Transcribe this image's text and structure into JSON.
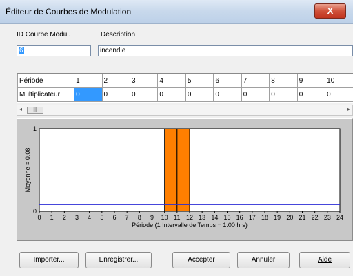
{
  "window": {
    "title": "Éditeur de Courbes de Modulation",
    "close_label": "X"
  },
  "form": {
    "id_label": "ID Courbe Modul.",
    "id_value": "6",
    "description_label": "Description",
    "description_value": "incendie"
  },
  "grid": {
    "row1_header": "Période",
    "row2_header": "Multiplicateur",
    "periods": [
      "1",
      "2",
      "3",
      "4",
      "5",
      "6",
      "7",
      "8",
      "9",
      "10"
    ],
    "multipliers": [
      "0",
      "0",
      "0",
      "0",
      "0",
      "0",
      "0",
      "0",
      "0",
      "0"
    ]
  },
  "scrollbar": {
    "left_arrow": "◂",
    "thumb": "|||",
    "right_arrow": "▸"
  },
  "chart_data": {
    "type": "bar",
    "x": [
      0,
      1,
      2,
      3,
      4,
      5,
      6,
      7,
      8,
      9,
      10,
      11,
      12,
      13,
      14,
      15,
      16,
      17,
      18,
      19,
      20,
      21,
      22,
      23,
      24
    ],
    "bars": [
      {
        "start": 10,
        "end": 11,
        "value": 1
      },
      {
        "start": 11,
        "end": 12,
        "value": 1
      }
    ],
    "bar_color": "#ff7f00",
    "mean_line_value": 0.08,
    "mean_line_color": "#2b2bd6",
    "xlabel": "Période (1 Intervalle de Temps = 1:00 hrs)",
    "ylabel": "Moyenne = 0.08",
    "ylim": [
      0,
      1
    ],
    "xlim": [
      0,
      24
    ],
    "yticks": [
      "0",
      "1"
    ],
    "grid": false
  },
  "buttons": {
    "import": "Importer...",
    "save": "Enregistrer...",
    "accept": "Accepter",
    "cancel": "Annuler",
    "help": "Aide"
  }
}
